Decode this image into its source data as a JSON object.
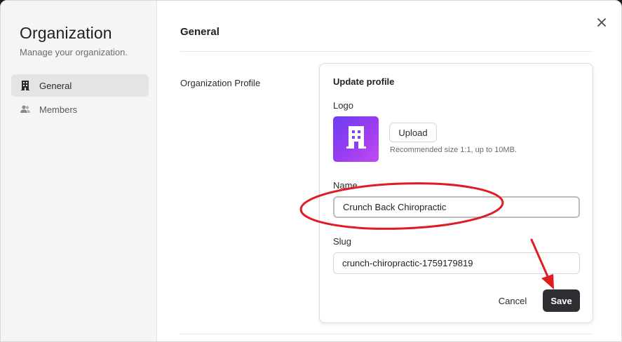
{
  "sidebar": {
    "title": "Organization",
    "subtitle": "Manage your organization.",
    "items": [
      {
        "label": "General",
        "icon": "building-icon",
        "active": true
      },
      {
        "label": "Members",
        "icon": "users-icon",
        "active": false
      }
    ]
  },
  "main": {
    "section_title": "General",
    "profile_label": "Organization Profile",
    "card": {
      "title": "Update profile",
      "logo_label": "Logo",
      "upload_label": "Upload",
      "upload_hint": "Recommended size 1:1, up to 10MB.",
      "name_label": "Name",
      "name_value": "Crunch Back Chiropractic",
      "slug_label": "Slug",
      "slug_value": "crunch-chiropractic-1759179819",
      "cancel_label": "Cancel",
      "save_label": "Save"
    }
  },
  "colors": {
    "accent_logo": "#8a3df2",
    "save_button": "#2f2f33",
    "annotation": "#e01b24"
  }
}
